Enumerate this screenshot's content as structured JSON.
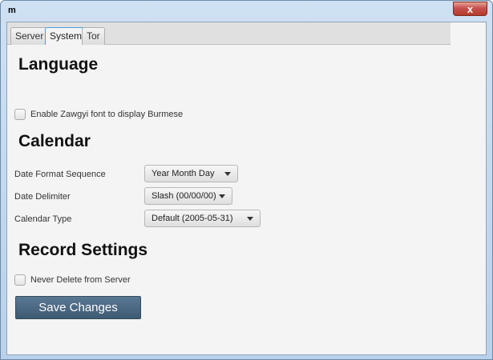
{
  "window": {
    "title": "m",
    "close_symbol": "x"
  },
  "tabs": [
    {
      "label": "Server",
      "active": false
    },
    {
      "label": "System",
      "active": true
    },
    {
      "label": "Tor",
      "active": false
    }
  ],
  "language": {
    "heading": "Language",
    "zawgyi_label": "Enable Zawgyi font to display Burmese",
    "zawgyi_checked": false
  },
  "calendar": {
    "heading": "Calendar",
    "date_format_label": "Date Format Sequence",
    "date_format_value": "Year Month Day",
    "date_delimiter_label": "Date Delimiter",
    "date_delimiter_value": "Slash (00/00/00)",
    "calendar_type_label": "Calendar Type",
    "calendar_type_value": "Default (2005-05-31)"
  },
  "record": {
    "heading": "Record Settings",
    "never_delete_label": "Never Delete from Server",
    "never_delete_checked": false
  },
  "actions": {
    "save_label": "Save Changes"
  },
  "colors": {
    "accent_tab": "#4aa0d8",
    "save_button": "#4a6781",
    "close_button": "#c75050"
  }
}
